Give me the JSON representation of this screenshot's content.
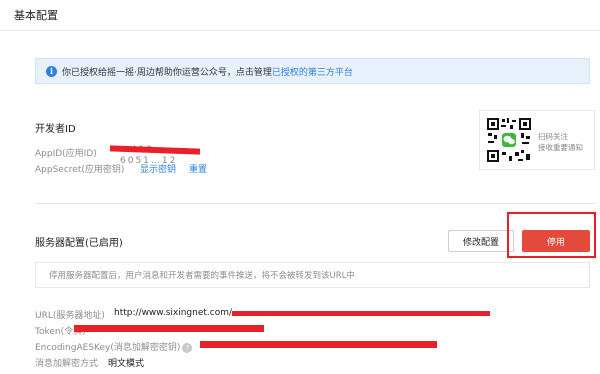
{
  "page": {
    "title": "基本配置"
  },
  "notice": {
    "icon": "info-icon",
    "text": "你已授权给摇一摇·周边帮助你运营公众号，点击管理",
    "link": "已授权的第三方平台"
  },
  "developer": {
    "title": "开发者ID",
    "appid_label": "AppID(应用ID)",
    "appid_value": "…419…6051…12",
    "appsecret_label": "AppSecret(应用密钥)",
    "show_secret": "显示密钥",
    "reset": "重置"
  },
  "qr_panel": {
    "line1": "扫码关注",
    "line2": "接收重要通知"
  },
  "server": {
    "title": "服务器配置(已启用)",
    "modify_button": "修改配置",
    "disable_button": "停用",
    "warning": "停用服务器配置后，用户消息和开发者需要的事件推送，将不会被转发到该URL中",
    "url_label": "URL(服务器地址)",
    "url_value": "http://www.sixingnet.com/",
    "token_label": "Token(令牌)",
    "aeskey_label": "EncodingAESKey(消息加解密密钥)",
    "encrypt_label": "消息加解密方式",
    "encrypt_value": "明文模式"
  },
  "colors": {
    "accent_link": "#2e80d8",
    "danger": "#e44a3c",
    "redaction": "#e8202a",
    "notice_bg": "#e8f1fb"
  }
}
